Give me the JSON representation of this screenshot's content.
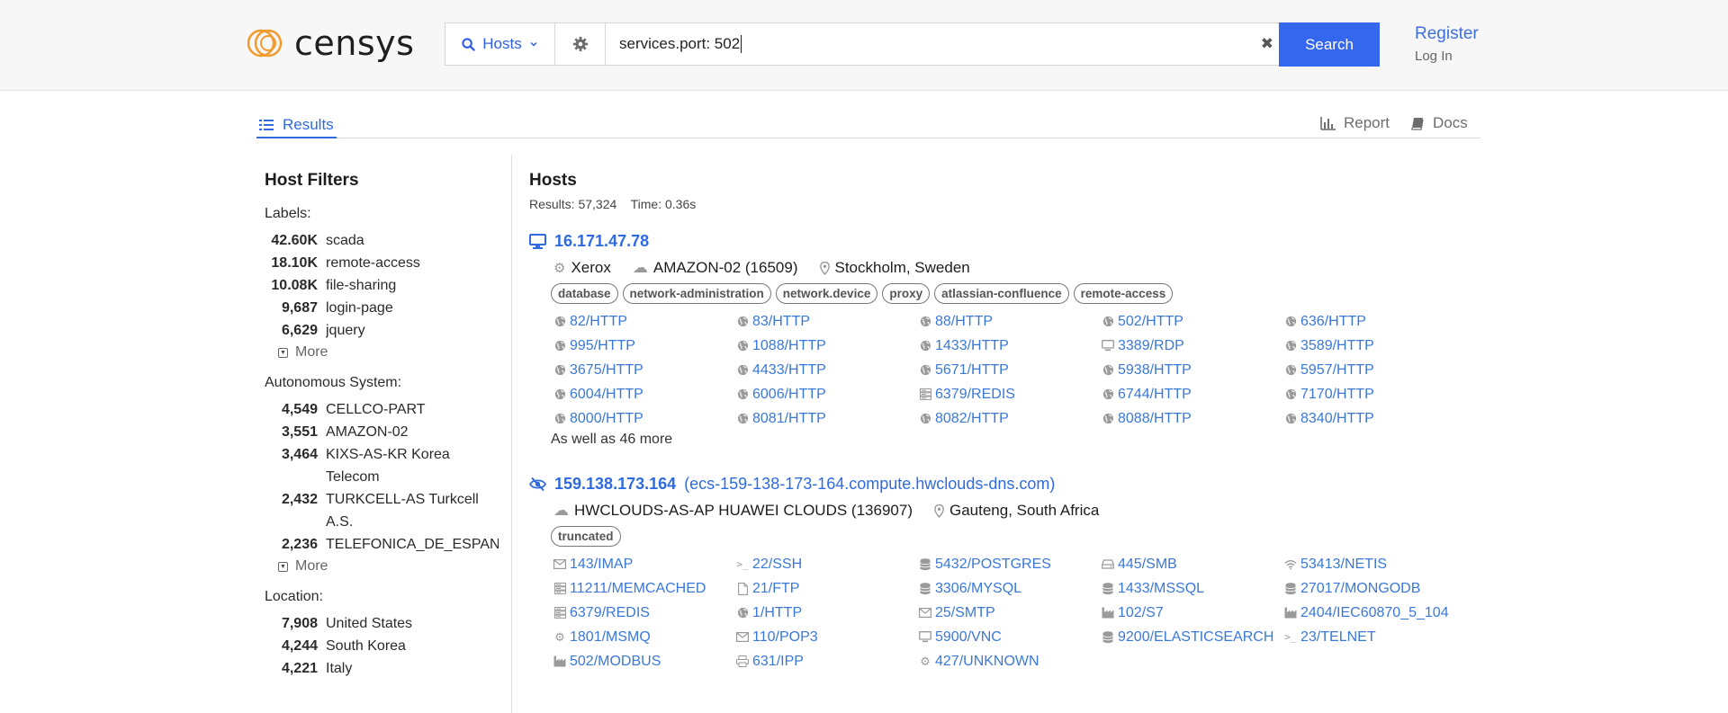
{
  "header": {
    "logo_text": "censys",
    "search_type": "Hosts",
    "query": "services.port: 502",
    "search_label": "Search",
    "register_label": "Register",
    "login_label": "Log In"
  },
  "tabs": {
    "results": "Results",
    "report": "Report",
    "docs": "Docs"
  },
  "sidebar": {
    "title": "Host Filters",
    "groups": [
      {
        "title": "Labels:",
        "items": [
          {
            "count": "42.60K",
            "label": "scada"
          },
          {
            "count": "18.10K",
            "label": "remote-access"
          },
          {
            "count": "10.08K",
            "label": "file-sharing"
          },
          {
            "count": "9,687",
            "label": "login-page"
          },
          {
            "count": "6,629",
            "label": "jquery"
          }
        ],
        "more": "More"
      },
      {
        "title": "Autonomous System:",
        "items": [
          {
            "count": "4,549",
            "label": "CELLCO-PART"
          },
          {
            "count": "3,551",
            "label": "AMAZON-02"
          },
          {
            "count": "3,464",
            "label": "KIXS-AS-KR Korea Telecom"
          },
          {
            "count": "2,432",
            "label": "TURKCELL-AS Turkcell A.S."
          },
          {
            "count": "2,236",
            "label": "TELEFONICA_DE_ESPAN"
          }
        ],
        "more": "More"
      },
      {
        "title": "Location:",
        "items": [
          {
            "count": "7,908",
            "label": "United States"
          },
          {
            "count": "4,244",
            "label": "South Korea"
          },
          {
            "count": "4,221",
            "label": "Italy"
          }
        ]
      }
    ]
  },
  "main": {
    "title": "Hosts",
    "results_text": "Results: 57,324",
    "time_text": "Time: 0.36s",
    "hosts": [
      {
        "ip": "16.171.47.78",
        "dns": "",
        "icon": "desktop-icon",
        "os": "Xerox",
        "asn": "AMAZON-02 (16509)",
        "location": "Stockholm, Sweden",
        "labels": [
          "database",
          "network-administration",
          "network.device",
          "proxy",
          "atlassian-confluence",
          "remote-access"
        ],
        "services": [
          {
            "icon": "globe",
            "text": "82/HTTP"
          },
          {
            "icon": "globe",
            "text": "83/HTTP"
          },
          {
            "icon": "globe",
            "text": "88/HTTP"
          },
          {
            "icon": "globe",
            "text": "502/HTTP"
          },
          {
            "icon": "globe",
            "text": "636/HTTP"
          },
          {
            "icon": "globe",
            "text": "995/HTTP"
          },
          {
            "icon": "globe",
            "text": "1088/HTTP"
          },
          {
            "icon": "globe",
            "text": "1433/HTTP"
          },
          {
            "icon": "monitor",
            "text": "3389/RDP"
          },
          {
            "icon": "globe",
            "text": "3589/HTTP"
          },
          {
            "icon": "globe",
            "text": "3675/HTTP"
          },
          {
            "icon": "globe",
            "text": "4433/HTTP"
          },
          {
            "icon": "globe",
            "text": "5671/HTTP"
          },
          {
            "icon": "globe",
            "text": "5938/HTTP"
          },
          {
            "icon": "globe",
            "text": "5957/HTTP"
          },
          {
            "icon": "globe",
            "text": "6004/HTTP"
          },
          {
            "icon": "globe",
            "text": "6006/HTTP"
          },
          {
            "icon": "server",
            "text": "6379/REDIS"
          },
          {
            "icon": "globe",
            "text": "6744/HTTP"
          },
          {
            "icon": "globe",
            "text": "7170/HTTP"
          },
          {
            "icon": "globe",
            "text": "8000/HTTP"
          },
          {
            "icon": "globe",
            "text": "8081/HTTP"
          },
          {
            "icon": "globe",
            "text": "8082/HTTP"
          },
          {
            "icon": "globe",
            "text": "8088/HTTP"
          },
          {
            "icon": "globe",
            "text": "8340/HTTP"
          }
        ],
        "more_text": "As well as 46 more"
      },
      {
        "ip": "159.138.173.164",
        "dns": "(ecs-159-138-173-164.compute.hwclouds-dns.com)",
        "icon": "eye-slash-icon",
        "os": "",
        "asn": "HWCLOUDS-AS-AP HUAWEI CLOUDS (136907)",
        "location": "Gauteng, South Africa",
        "labels": [
          "truncated"
        ],
        "services": [
          {
            "icon": "mail",
            "text": "143/IMAP"
          },
          {
            "icon": "terminal",
            "text": "22/SSH"
          },
          {
            "icon": "database",
            "text": "5432/POSTGRES"
          },
          {
            "icon": "drive",
            "text": "445/SMB"
          },
          {
            "icon": "wifi",
            "text": "53413/NETIS"
          },
          {
            "icon": "server",
            "text": "11211/MEMCACHED"
          },
          {
            "icon": "file",
            "text": "21/FTP"
          },
          {
            "icon": "database",
            "text": "3306/MYSQL"
          },
          {
            "icon": "database",
            "text": "1433/MSSQL"
          },
          {
            "icon": "database",
            "text": "27017/MONGODB"
          },
          {
            "icon": "server",
            "text": "6379/REDIS"
          },
          {
            "icon": "globe",
            "text": "1/HTTP"
          },
          {
            "icon": "mail",
            "text": "25/SMTP"
          },
          {
            "icon": "factory",
            "text": "102/S7"
          },
          {
            "icon": "factory",
            "text": "2404/IEC60870_5_104"
          },
          {
            "icon": "gear",
            "text": "1801/MSMQ"
          },
          {
            "icon": "mail",
            "text": "110/POP3"
          },
          {
            "icon": "monitor",
            "text": "5900/VNC"
          },
          {
            "icon": "database",
            "text": "9200/ELASTICSEARCH"
          },
          {
            "icon": "terminal",
            "text": "23/TELNET"
          },
          {
            "icon": "factory",
            "text": "502/MODBUS"
          },
          {
            "icon": "printer",
            "text": "631/IPP"
          },
          {
            "icon": "gear",
            "text": "427/UNKNOWN"
          }
        ],
        "more_text": ""
      }
    ]
  },
  "colors": {
    "accent": "#3466ee",
    "link": "#2f6be0",
    "logo_orange": "#f39a2c"
  }
}
